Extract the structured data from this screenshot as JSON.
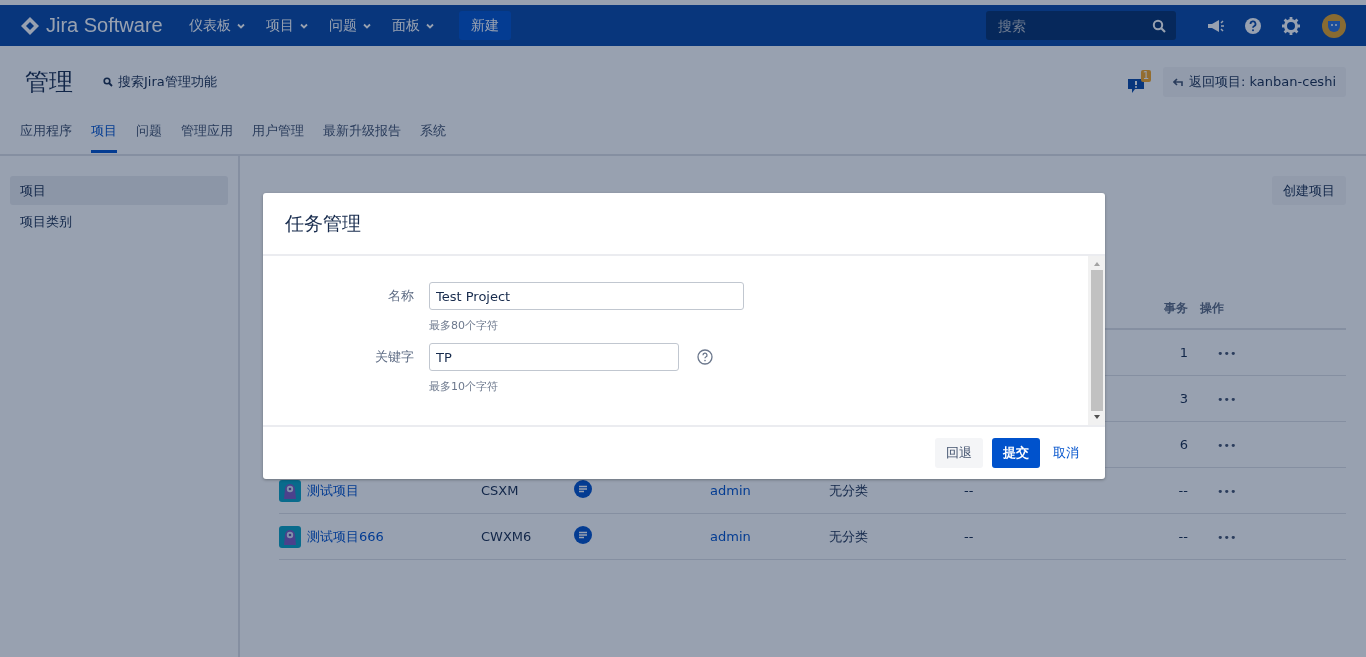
{
  "top_nav": {
    "logo": "Jira Software",
    "menus": [
      {
        "label": "仪表板"
      },
      {
        "label": "项目"
      },
      {
        "label": "问题"
      },
      {
        "label": "面板"
      }
    ],
    "create_button": "新建",
    "search": {
      "placeholder": "搜索"
    }
  },
  "admin_header": {
    "title": "管理",
    "search_link": "搜索Jira管理功能",
    "notification_count": "1",
    "back_button": "返回项目: kanban-ceshi"
  },
  "admin_tabs": [
    {
      "label": "应用程序",
      "selected": false
    },
    {
      "label": "项目",
      "selected": true
    },
    {
      "label": "问题",
      "selected": false
    },
    {
      "label": "管理应用",
      "selected": false
    },
    {
      "label": "用户管理",
      "selected": false
    },
    {
      "label": "最新升级报告",
      "selected": false
    },
    {
      "label": "系统",
      "selected": false
    }
  ],
  "sidebar": {
    "items": [
      {
        "label": "项目",
        "selected": true
      },
      {
        "label": "项目类别",
        "selected": false
      }
    ]
  },
  "main": {
    "create_button": "创建项目",
    "table": {
      "columns": [
        {
          "label": "事务"
        },
        {
          "label": "操作"
        }
      ],
      "rows": [
        {
          "issues": "1",
          "actions": "•••"
        },
        {
          "issues": "3",
          "actions": "•••"
        },
        {
          "issues": "6",
          "actions": "•••"
        },
        {
          "name": "测试项目",
          "key": "CSXM",
          "lead": "admin",
          "category": "无分类",
          "url": "--",
          "issues": "--",
          "actions": "•••"
        },
        {
          "name": "测试项目666",
          "key": "CWXM6",
          "lead": "admin",
          "category": "无分类",
          "url": "--",
          "issues": "--",
          "actions": "•••"
        }
      ]
    }
  },
  "dialog": {
    "title": "任务管理",
    "fields": [
      {
        "label": "名称",
        "value": "Test Project",
        "hint": "最多80个字符",
        "help": false
      },
      {
        "label": "关键字",
        "value": "TP",
        "hint": "最多10个字符",
        "help": true
      }
    ],
    "buttons": [
      {
        "label": "回退",
        "kind": "secondary"
      },
      {
        "label": "提交",
        "kind": "primary"
      },
      {
        "label": "取消",
        "kind": "link"
      }
    ]
  }
}
